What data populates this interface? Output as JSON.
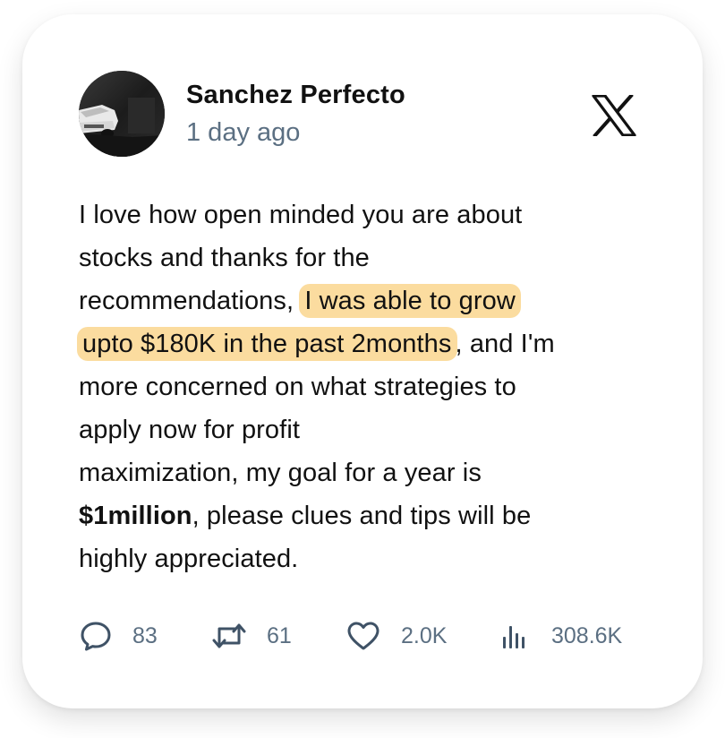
{
  "post": {
    "author_name": "Sanchez Perfecto",
    "timestamp": "1 day ago",
    "platform_icon": "x-logo-icon",
    "avatar_icon": "car-photo-avatar",
    "body": {
      "line1": "I love how open minded you are about",
      "line2": "stocks and thanks for the",
      "line3_plain": "recommendations, ",
      "line3_highlight": "I was able to grow",
      "line4_highlight": "upto $180K in the past 2months",
      "line4_plain": ", and I'm",
      "line5": "more concerned on what strategies to",
      "line6": "apply now for profit",
      "line7": "maximization, my goal for a year is",
      "line8_bold": "$1million",
      "line8_plain": ", please clues and tips will be",
      "line9": "highly appreciated."
    },
    "highlight_color": "#fbdc9f"
  },
  "actions": {
    "replies": {
      "icon": "reply-bubble-icon",
      "count": "83"
    },
    "reposts": {
      "icon": "repost-icon",
      "count": "61"
    },
    "likes": {
      "icon": "heart-icon",
      "count": "2.0K"
    },
    "views": {
      "icon": "views-bar-chart-icon",
      "count": "308.6K"
    }
  }
}
